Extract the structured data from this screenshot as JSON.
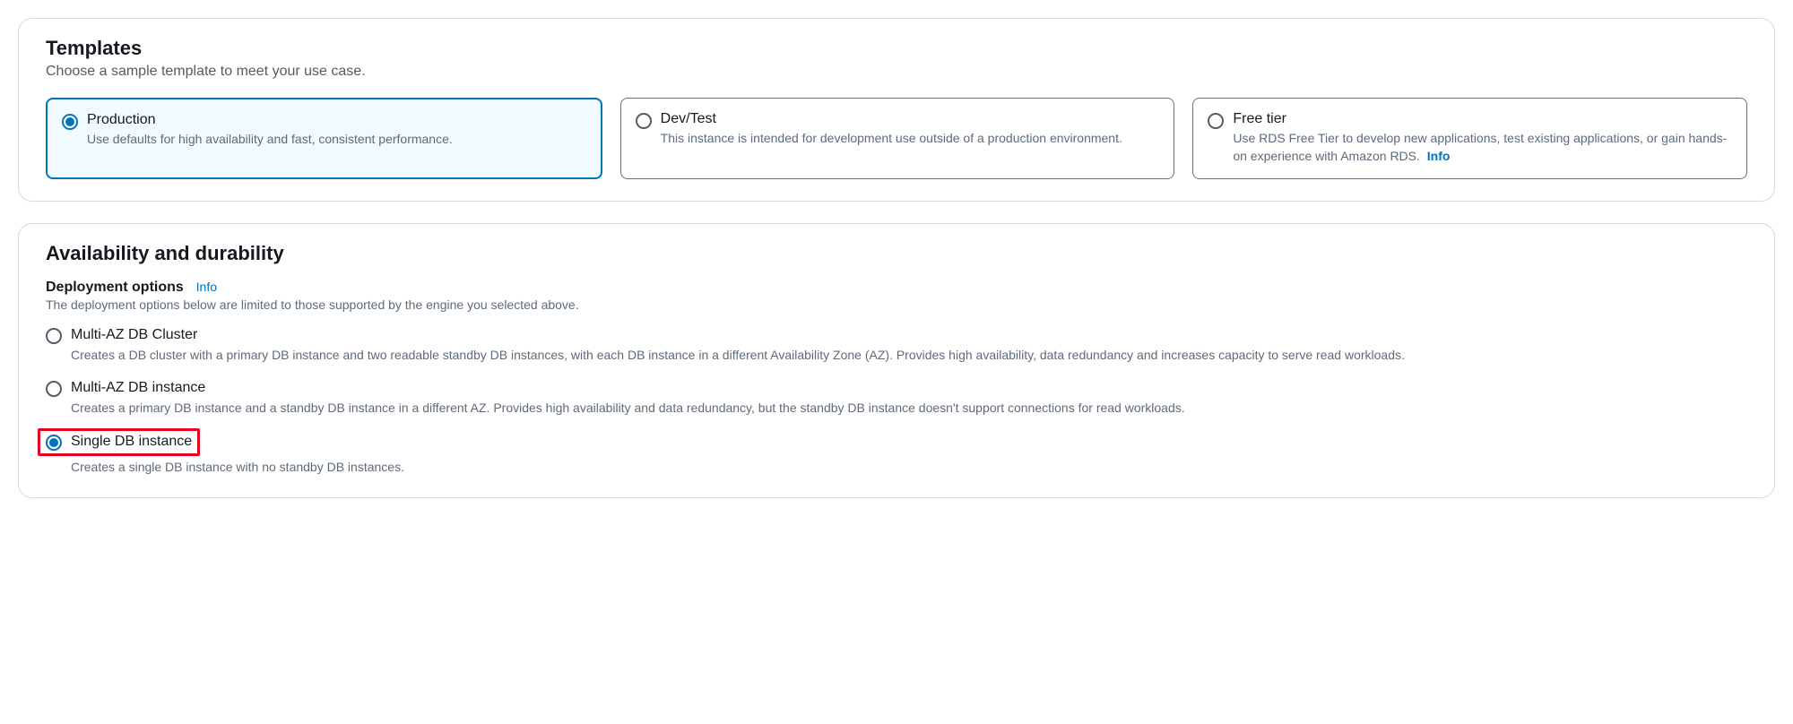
{
  "templates": {
    "title": "Templates",
    "subtitle": "Choose a sample template to meet your use case.",
    "options": [
      {
        "title": "Production",
        "desc": "Use defaults for high availability and fast, consistent performance.",
        "selected": true
      },
      {
        "title": "Dev/Test",
        "desc": "This instance is intended for development use outside of a production environment.",
        "selected": false
      },
      {
        "title": "Free tier",
        "desc": "Use RDS Free Tier to develop new applications, test existing applications, or gain hands-on experience with Amazon RDS. ",
        "info": "Info",
        "selected": false
      }
    ]
  },
  "availability": {
    "title": "Availability and durability",
    "deployment_label": "Deployment options",
    "info": "Info",
    "hint": "The deployment options below are limited to those supported by the engine you selected above.",
    "options": [
      {
        "title": "Multi-AZ DB Cluster",
        "desc": "Creates a DB cluster with a primary DB instance and two readable standby DB instances, with each DB instance in a different Availability Zone (AZ). Provides high availability, data redundancy and increases capacity to serve read workloads.",
        "selected": false
      },
      {
        "title": "Multi-AZ DB instance",
        "desc": "Creates a primary DB instance and a standby DB instance in a different AZ. Provides high availability and data redundancy, but the standby DB instance doesn't support connections for read workloads.",
        "selected": false
      },
      {
        "title": "Single DB instance",
        "desc": "Creates a single DB instance with no standby DB instances.",
        "selected": true
      }
    ]
  }
}
